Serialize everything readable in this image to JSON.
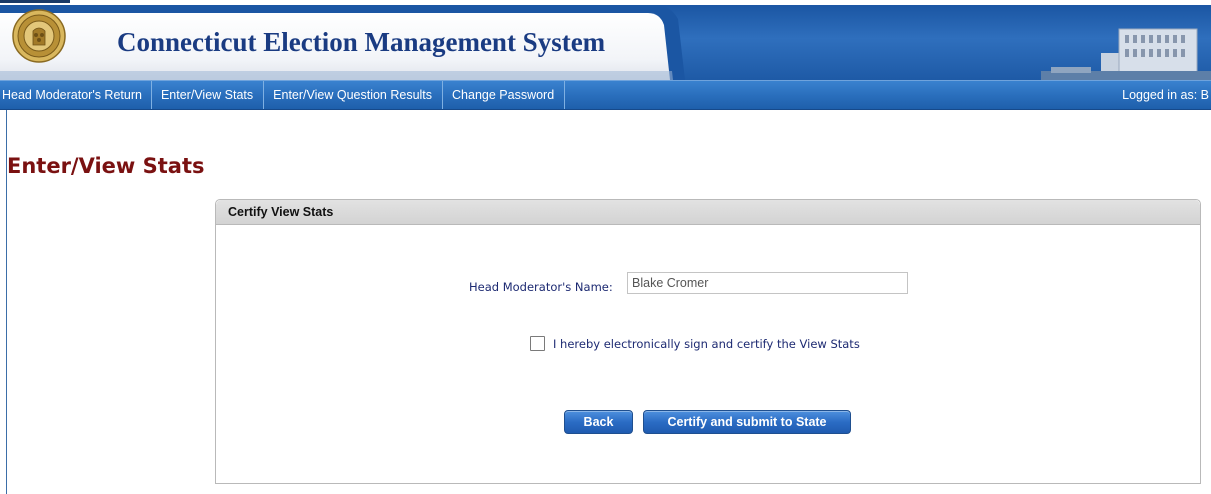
{
  "header": {
    "app_title": "Connecticut Election Management System",
    "seal_icon": "state-seal-icon",
    "capitol_image": "capitol-building-image"
  },
  "nav": {
    "items": [
      {
        "label": "Head Moderator's Return"
      },
      {
        "label": "Enter/View Stats"
      },
      {
        "label": "Enter/View Question Results"
      },
      {
        "label": "Change Password"
      }
    ],
    "logged_in": "Logged in as: B"
  },
  "page": {
    "title": "Enter/View Stats"
  },
  "panel": {
    "title": "Certify View Stats",
    "name_label": "Head Moderator's Name:",
    "name_value": "Blake Cromer",
    "certify_label": "I hereby electronically sign and certify the View Stats",
    "certify_checked": false,
    "back_button": "Back",
    "submit_button": "Certify and submit to State"
  },
  "colors": {
    "banner_blue": "#1b56a3",
    "title_navy": "#1a3b82",
    "page_title_red": "#7a1111",
    "label_navy": "#1d2a72"
  }
}
